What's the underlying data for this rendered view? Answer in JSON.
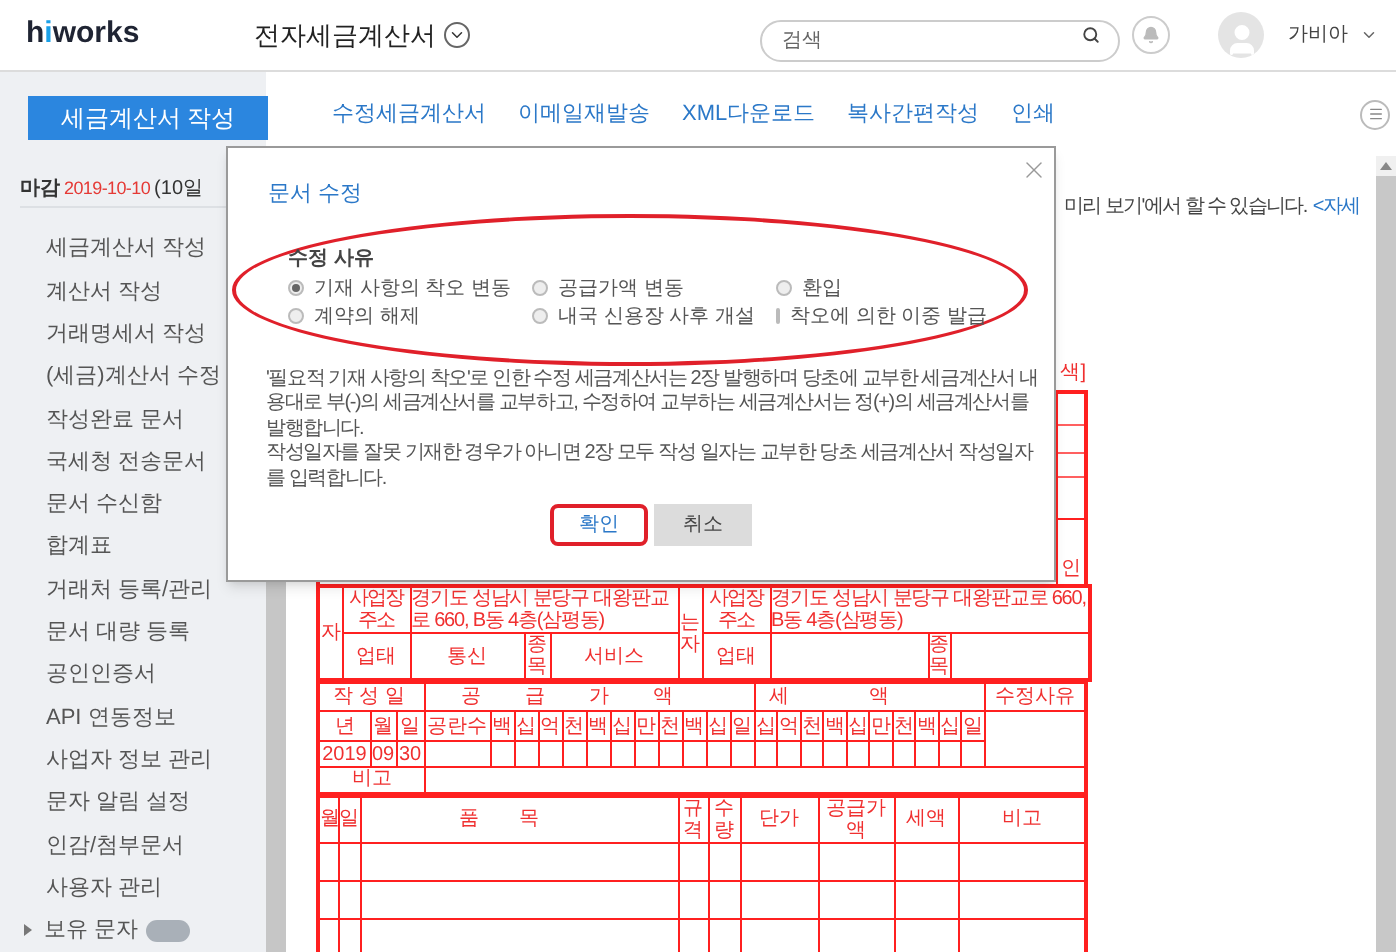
{
  "header": {
    "logo": [
      {
        "text": "h",
        "accent": false
      },
      {
        "text": "i",
        "accent": true
      },
      {
        "text": "works",
        "accent": false
      }
    ],
    "app_title": "전자세금계산서",
    "search": {
      "placeholder": "검색"
    },
    "user": {
      "name": "가비아"
    }
  },
  "sidebar": {
    "primary_button": "세금계산서 작성",
    "deadline": {
      "label": "마감",
      "date": "2019-10-10",
      "remaining": "(10일"
    },
    "items": [
      {
        "label": "세금계산서 작성",
        "kind": "link"
      },
      {
        "label": "계산서 작성",
        "kind": "link"
      },
      {
        "label": "거래명세서 작성",
        "kind": "link"
      },
      {
        "label": "(세금)계산서 수정",
        "kind": "link"
      },
      {
        "label": "작성완료 문서",
        "kind": "link"
      },
      {
        "label": "국세청 전송문서",
        "kind": "link"
      },
      {
        "label": "문서 수신함",
        "kind": "link"
      },
      {
        "label": "합계표",
        "kind": "link"
      },
      {
        "label": "거래처 등록/관리",
        "kind": "link"
      },
      {
        "label": "문서 대량 등록",
        "kind": "link"
      },
      {
        "label": "공인인증서",
        "kind": "link"
      },
      {
        "label": "API 연동정보",
        "kind": "link"
      },
      {
        "label": "사업자 정보 관리",
        "kind": "link"
      },
      {
        "label": "문자 알림 설정",
        "kind": "link"
      },
      {
        "label": "인감/첨부문서",
        "kind": "link"
      },
      {
        "label": "사용자 관리",
        "kind": "link"
      },
      {
        "label": "보유 문자",
        "kind": "expandable"
      }
    ]
  },
  "toolbar": {
    "links": [
      "수정세금계산서",
      "이메일재발송",
      "XML다운로드",
      "복사간편작성",
      "인쇄"
    ]
  },
  "notice": {
    "text": "미리 보기'에서 할 수 있습니다.",
    "link": "<자세"
  },
  "document": {
    "corner_texts": [
      "색]",
      "인"
    ],
    "parties": [
      {
        "side_label": "자",
        "address_label": "사업장 주소",
        "address": "경기도 성남시 분당구 대왕판교로 660, B동 4층(삼평동)",
        "business_type_label": "업태",
        "business_type": "통신",
        "item_label": "종목",
        "item": "서비스"
      },
      {
        "side_label": "는자",
        "address_label": "사업장 주소",
        "address": "경기도 성남시 분당구 대왕판교로 660, B동 4층(삼평동)",
        "business_type_label": "업태",
        "item_label": "종목"
      }
    ],
    "amounts": {
      "date_header": "작성일",
      "supply_header": "공급가액",
      "tax_header": "세액",
      "reason_header": "수정사유",
      "date_units": [
        "년",
        "월",
        "일"
      ],
      "supply_units": [
        "공란수",
        "백",
        "십",
        "억",
        "천",
        "백",
        "십",
        "만",
        "천",
        "백",
        "십",
        "일"
      ],
      "tax_units": [
        "십",
        "억",
        "천",
        "백",
        "십",
        "만",
        "천",
        "백",
        "십",
        "일"
      ],
      "date": [
        "2019",
        "09",
        "30"
      ],
      "note_label": "비고"
    },
    "items": {
      "columns": [
        "월",
        "일",
        "품목",
        "규격",
        "수량",
        "단가",
        "공급가액",
        "세액",
        "비고"
      ]
    }
  },
  "dialog": {
    "title": "문서 수정",
    "reason_group": {
      "label": "수정 사유",
      "circled": true,
      "options": [
        {
          "label": "기재 사항의 착오 변동",
          "selected": true
        },
        {
          "label": "공급가액 변동",
          "selected": false
        },
        {
          "label": "환입",
          "selected": false
        },
        {
          "label": "계약의 해제",
          "selected": false
        },
        {
          "label": "내국 신용장 사후 개설",
          "selected": false
        },
        {
          "label": "착오에 의한 이중 발급",
          "selected": false
        }
      ]
    },
    "notes": [
      "'필요적 기재 사항의 착오'로 인한 수정 세금계산서는 2장 발행하며 당초에 교부한 세금계산서 내용대로 부(-)의 세금계산서를 교부하고, 수정하여 교부하는 세금계산서는 정(+)의 세금계산서를 발행합니다.",
      "작성일자를 잘못 기재한 경우가 아니면 2장 모두 작성 일자는 교부한 당초 세금계산서 작성일자를 입력합니다."
    ],
    "buttons": [
      {
        "label": "확인",
        "kind": "primary",
        "circled": true
      },
      {
        "label": "취소",
        "kind": "secondary",
        "circled": false
      }
    ]
  }
}
